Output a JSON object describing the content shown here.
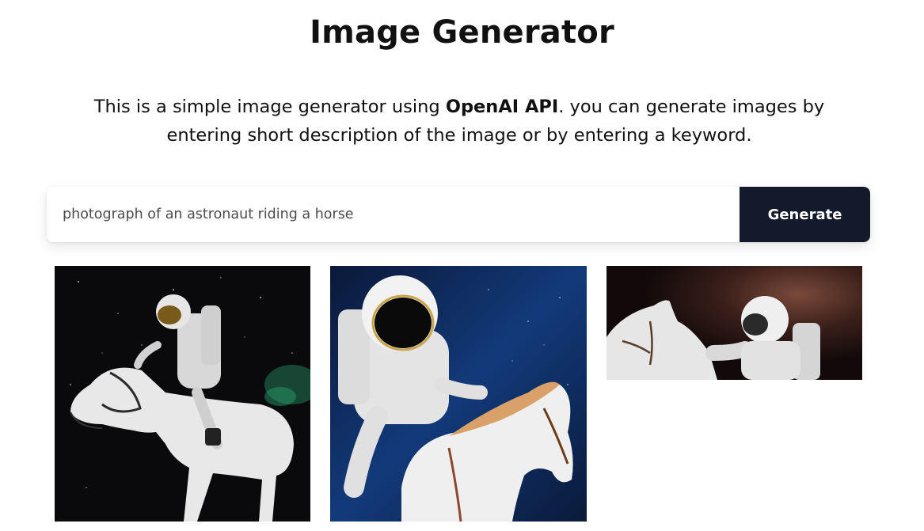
{
  "header": {
    "title": "Image Generator"
  },
  "description": {
    "prefix": "This is a simple image generator using ",
    "highlight": "OpenAI API",
    "suffix": ". you can generate images by entering short description of the image or by entering a keyword."
  },
  "search": {
    "value": "photograph of an astronaut riding a horse",
    "placeholder": ""
  },
  "generate_button": {
    "label": "Generate",
    "color": "#121a2c"
  },
  "gallery": {
    "images": [
      {
        "subject": "astronaut riding white horse in starry space"
      },
      {
        "subject": "astronaut riding horse with galaxy background"
      },
      {
        "subject": "astronaut beside white horse in nebula space"
      }
    ]
  }
}
